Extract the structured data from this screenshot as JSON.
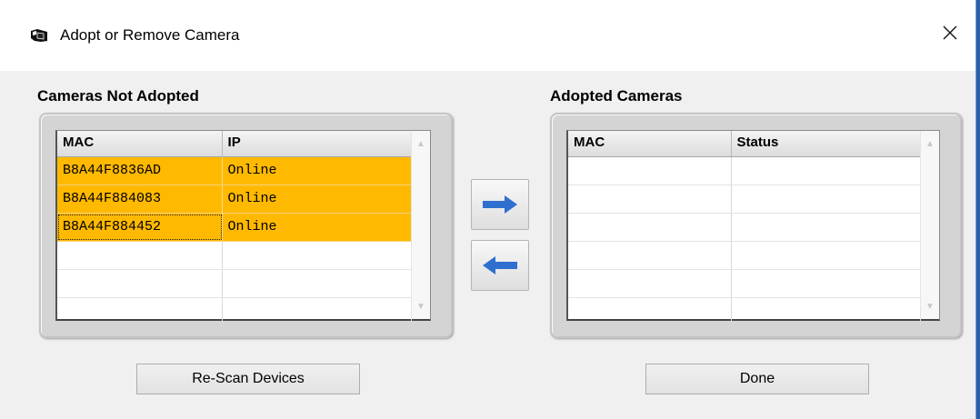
{
  "window": {
    "title": "Adopt or Remove Camera",
    "icon": "camera-app-icon",
    "close_icon": "close-icon"
  },
  "left_panel": {
    "title": "Cameras Not Adopted",
    "columns": [
      "MAC",
      "IP"
    ],
    "rows": [
      {
        "mac": "B8A44F8836AD",
        "ip": "Online",
        "selected": true
      },
      {
        "mac": "B8A44F884083",
        "ip": "Online",
        "selected": true
      },
      {
        "mac": "B8A44F884452",
        "ip": "Online",
        "selected": true,
        "focused": true
      }
    ],
    "empty_rows": 3
  },
  "right_panel": {
    "title": "Adopted Cameras",
    "columns": [
      "MAC",
      "Status"
    ],
    "rows": [],
    "empty_rows": 6
  },
  "transfer_buttons": {
    "adopt_icon": "arrow-right-icon",
    "remove_icon": "arrow-left-icon"
  },
  "buttons": {
    "rescan_label": "Re-Scan Devices",
    "done_label": "Done"
  },
  "colors": {
    "selection": "#ffb900",
    "arrow": "#2f6fd0",
    "panel": "#d4d4d4"
  }
}
